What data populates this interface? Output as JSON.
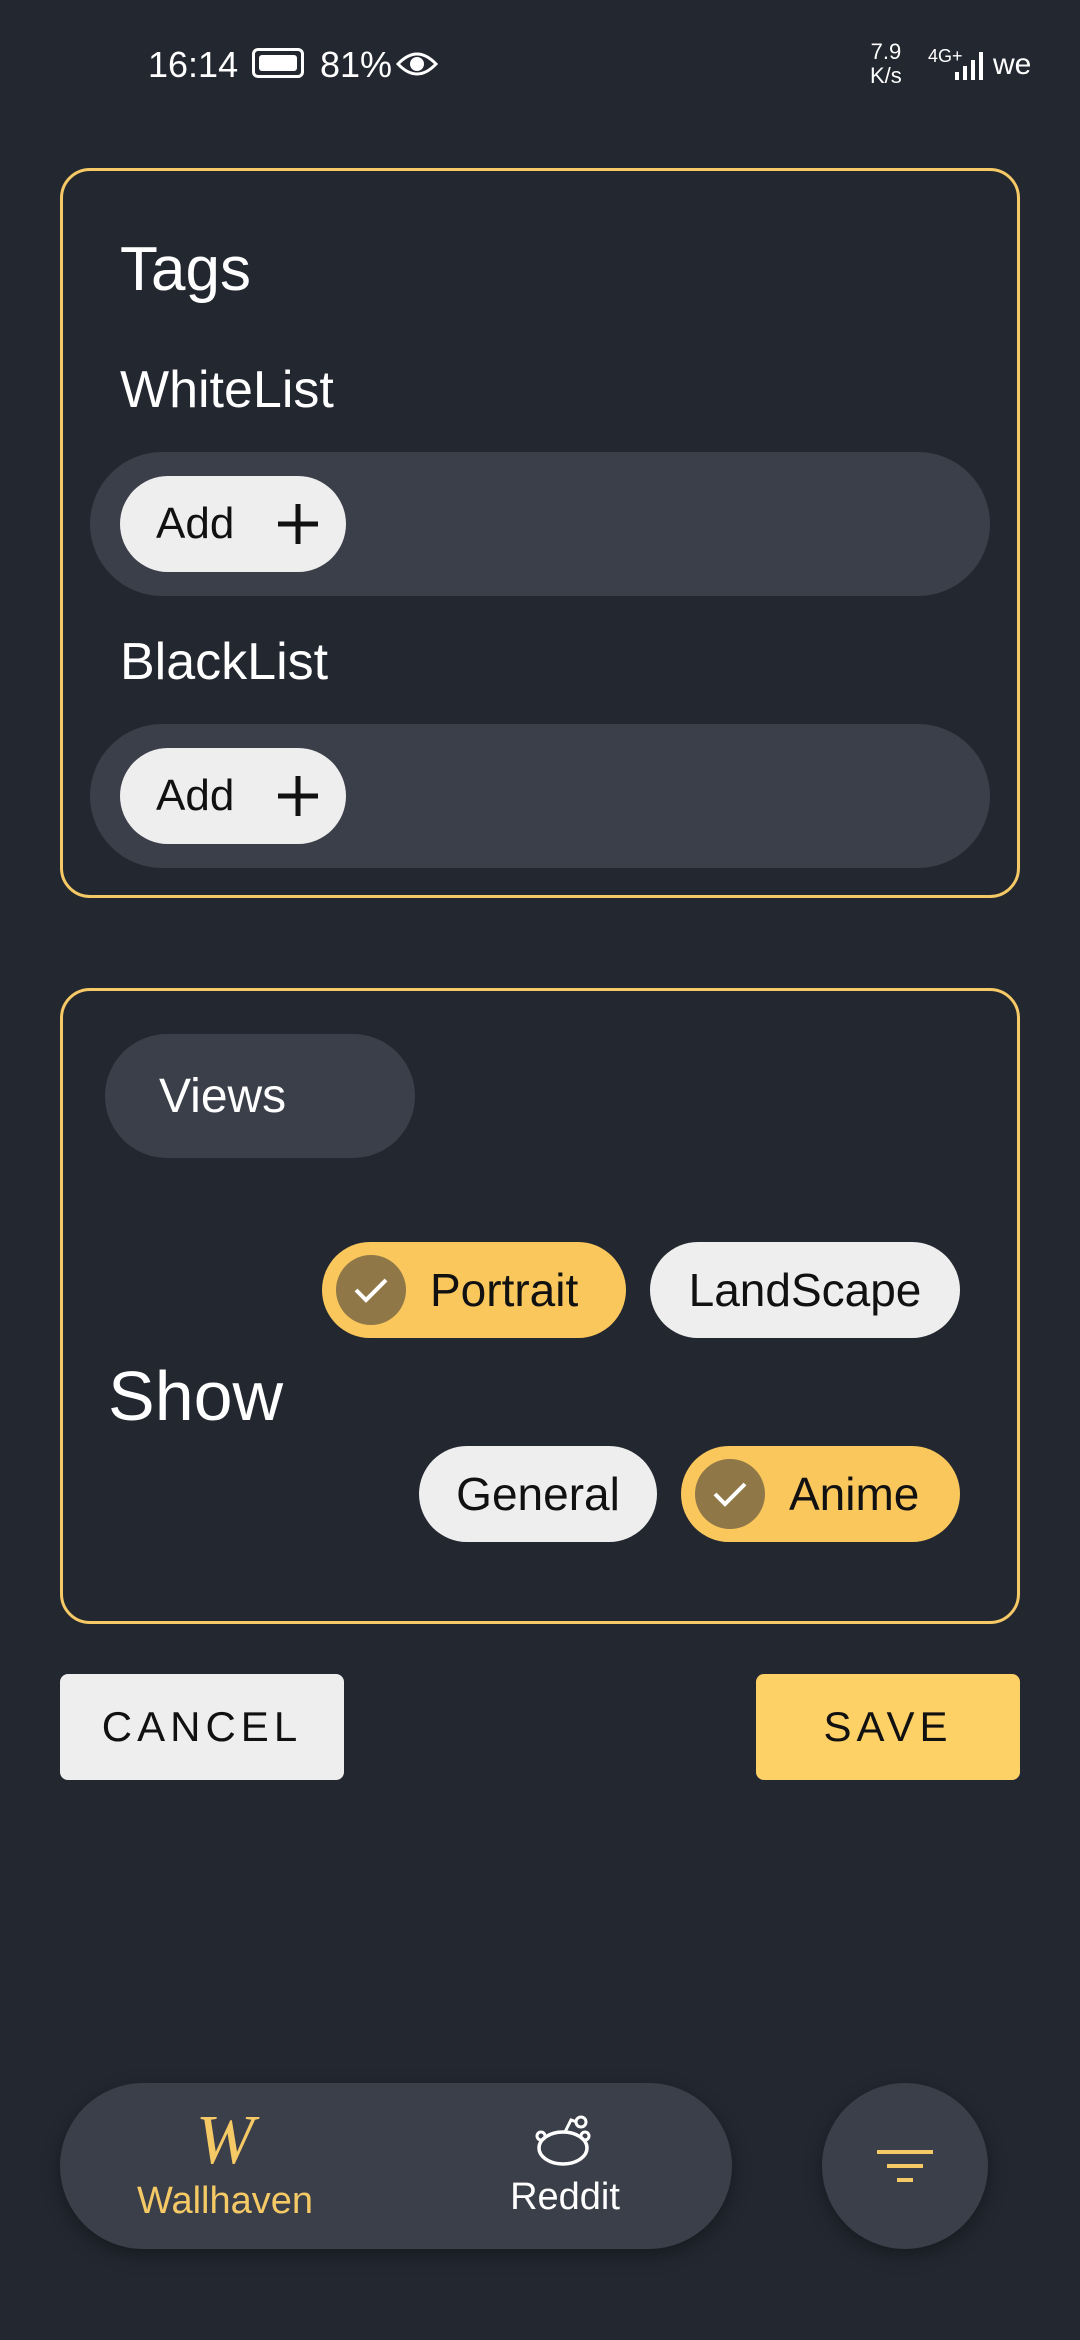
{
  "status_bar": {
    "time": "16:14",
    "battery_percent": "81%",
    "net_speed_top": "7.9",
    "net_speed_bottom": "K/s",
    "network_type": "4G+",
    "carrier": "we"
  },
  "tags_card": {
    "title": "Tags",
    "whitelist_label": "WhiteList",
    "blacklist_label": "BlackList",
    "add_label": "Add"
  },
  "views_card": {
    "views_label": "Views",
    "show_label": "Show",
    "chips": {
      "portrait": {
        "label": "Portrait",
        "selected": true
      },
      "landscape": {
        "label": "LandScape",
        "selected": false
      },
      "general": {
        "label": "General",
        "selected": false
      },
      "anime": {
        "label": "Anime",
        "selected": true
      }
    }
  },
  "actions": {
    "cancel_label": "CANCEL",
    "save_label": "SAVE"
  },
  "bottom_nav": {
    "items": [
      {
        "label": "Wallhaven",
        "icon": "wallhaven-logo-icon",
        "active": true
      },
      {
        "label": "Reddit",
        "icon": "reddit-icon",
        "active": false
      }
    ],
    "fab_icon": "filter-icon"
  },
  "colors": {
    "background": "#232730",
    "accent": "#f5c965",
    "surface": "#3b3f49",
    "chip_light": "#eeeeee"
  }
}
